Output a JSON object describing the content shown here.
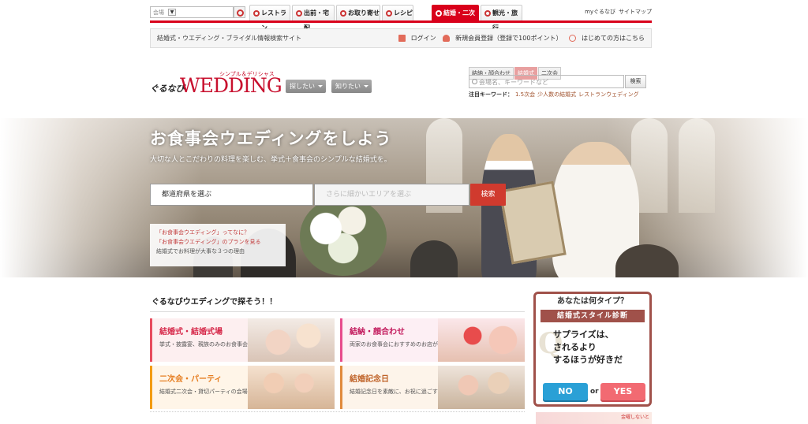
{
  "global_nav": {
    "select_value": "会場",
    "tabs": [
      {
        "label": "レストラン",
        "active": false
      },
      {
        "label": "出前・宅配",
        "active": false
      },
      {
        "label": "お取り寄せ",
        "active": false
      },
      {
        "label": "レシピ",
        "active": false
      },
      {
        "label": "結婚・二次会",
        "active": true
      },
      {
        "label": "観光・旅行",
        "active": false
      }
    ],
    "my_link": "myぐるなび",
    "sitemap_link": "サイトマップ",
    "accent_color": "#d9001b"
  },
  "info_bar": {
    "tagline": "結婚式・ウエディング・ブライダル情報検索サイト",
    "login": "ログイン",
    "register": "新規会員登録（登録で100ポイント）",
    "first_time": "はじめての方はこちら"
  },
  "logo": {
    "gurunavi": "ぐるなび",
    "wedding": "WEDDING",
    "subtitle": "シンプル＆デリシャス"
  },
  "menus": {
    "search_menu": "探したい",
    "know_menu": "知りたい"
  },
  "search": {
    "tabs": [
      {
        "label": "結納・顔合わせ",
        "active": false
      },
      {
        "label": "結婚式",
        "active": true
      },
      {
        "label": "二次会",
        "active": false
      }
    ],
    "placeholder": "会場名、キーワードなど",
    "button": "検索",
    "keywords_label": "注目キーワード：",
    "keywords": [
      "1.5次会",
      "少人数の結婚式",
      "レストランウェディング"
    ]
  },
  "hero": {
    "title": "お食事会ウエディングをしよう",
    "subtitle": "大切な人とこだわりの料理を楽しむ、挙式＋食事会のシンプルな結婚式を。",
    "prefecture_placeholder": "都道府県を選ぶ",
    "area_placeholder": "さらに細かいエリアを選ぶ",
    "search_button": "検索",
    "links": [
      "「お食事会ウエディング」ってなに？",
      "「お食事会ウエディング」のプランを見る",
      "結婚式でお料理が大事な３つの理由"
    ]
  },
  "categories": {
    "section_title": "ぐるなびウエディングで探そう！！",
    "cards": [
      {
        "title": "結婚式・結婚式場",
        "desc": "挙式・披露宴、親族のみのお食事会も！"
      },
      {
        "title": "結納・顔合わせ",
        "desc": "両家のお食事会におすすめのお店が満載"
      },
      {
        "title": "二次会・パーティ",
        "desc": "結婚式二次会・貸切パーティの会場探し"
      },
      {
        "title": "結婚記念日",
        "desc": "結婚記念日を素敵に、お祝に過ごすなら！"
      }
    ]
  },
  "quiz": {
    "header": "あなたは何タイプ？",
    "band": "結婚式スタイル診断",
    "q_mark": "Q",
    "question_lines": [
      "サプライズは、",
      "されるより",
      "するほうが好きだ"
    ],
    "no": "NO",
    "or": "or",
    "yes": "YES",
    "border_color": "#a0514a"
  },
  "bottom_banner": {
    "text": "金曜しないと"
  }
}
